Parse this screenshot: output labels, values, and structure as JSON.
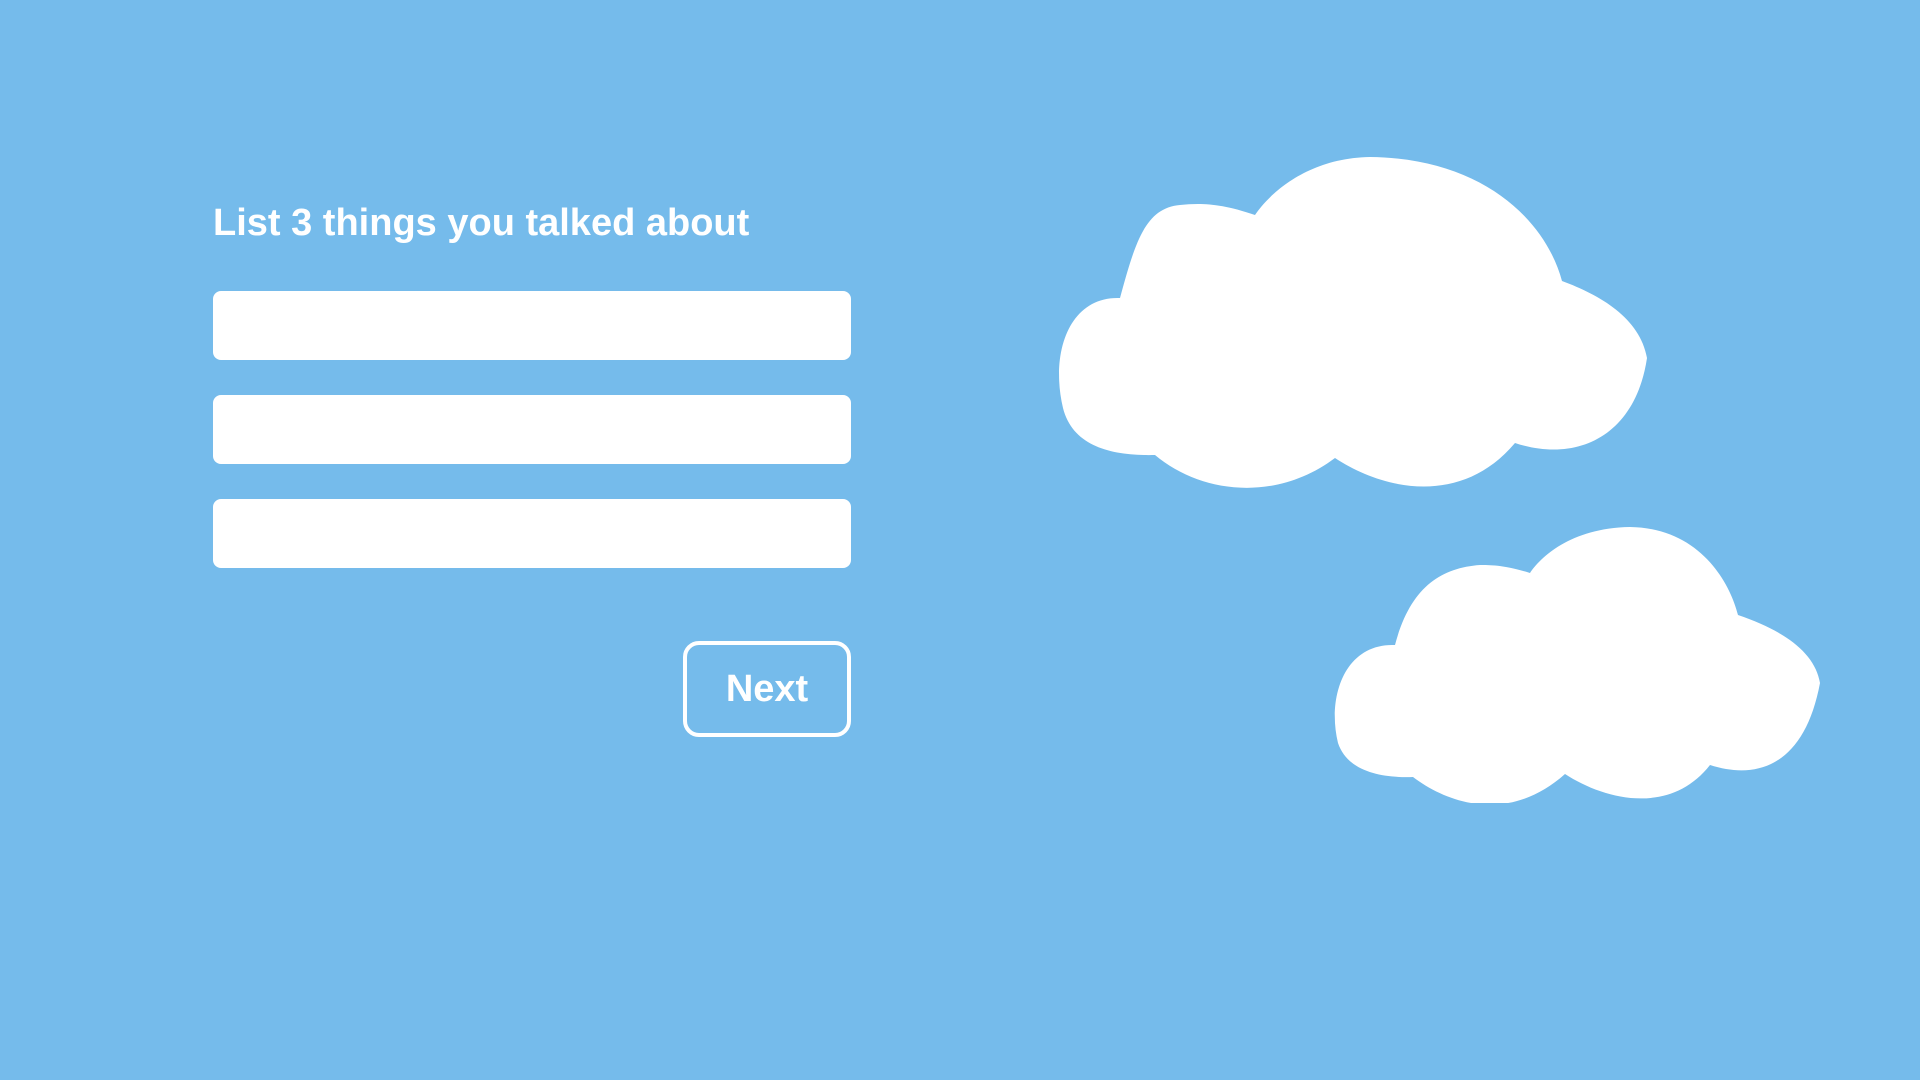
{
  "prompt": {
    "text": "List 3 things you talked about"
  },
  "answers": [
    {
      "value": "",
      "placeholder": ""
    },
    {
      "value": "",
      "placeholder": ""
    },
    {
      "value": "",
      "placeholder": ""
    }
  ],
  "buttons": {
    "next_label": "Next"
  },
  "decorations": {
    "clouds": [
      "cloud-large",
      "cloud-small"
    ]
  },
  "colors": {
    "background": "#75BBEB",
    "foreground": "#FFFFFF"
  }
}
